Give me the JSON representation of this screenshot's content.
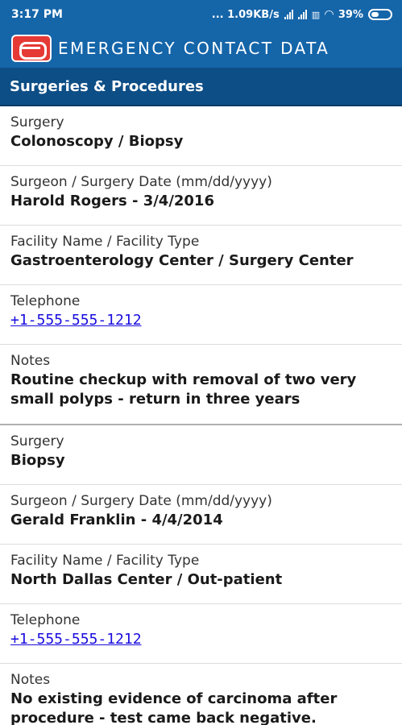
{
  "status_bar": {
    "time": "3:17 PM",
    "network_speed": "... 1.09KB/s",
    "battery": "39%",
    "colors": {
      "background": "#1565a9"
    }
  },
  "app": {
    "title": "EMERGENCY CONTACT DATA",
    "logo_icon": "emergency-logo-icon"
  },
  "section": {
    "title": "Surgeries & Procedures"
  },
  "records": [
    {
      "surgery_label": "Surgery",
      "surgery_value": "Colonoscopy / Biopsy",
      "surgeon_label": "Surgeon / Surgery Date (mm/dd/yyyy)",
      "surgeon_value": "Harold Rogers - 3/4/2016",
      "facility_label": "Facility Name / Facility Type",
      "facility_value": "Gastroenterology Center / Surgery Center",
      "phone_label": "Telephone",
      "phone_value": "+1-555-555-1212",
      "notes_label": "Notes",
      "notes_value": "Routine checkup with removal of two very small polyps - return in three years"
    },
    {
      "surgery_label": "Surgery",
      "surgery_value": "Biopsy",
      "surgeon_label": "Surgeon / Surgery Date (mm/dd/yyyy)",
      "surgeon_value": "Gerald Franklin - 4/4/2014",
      "facility_label": "Facility Name / Facility Type",
      "facility_value": "North Dallas Center / Out-patient",
      "phone_label": "Telephone",
      "phone_value": "+1-555-555-1212",
      "notes_label": "Notes",
      "notes_value": "No existing evidence of carcinoma after procedure - test came back negative."
    }
  ]
}
